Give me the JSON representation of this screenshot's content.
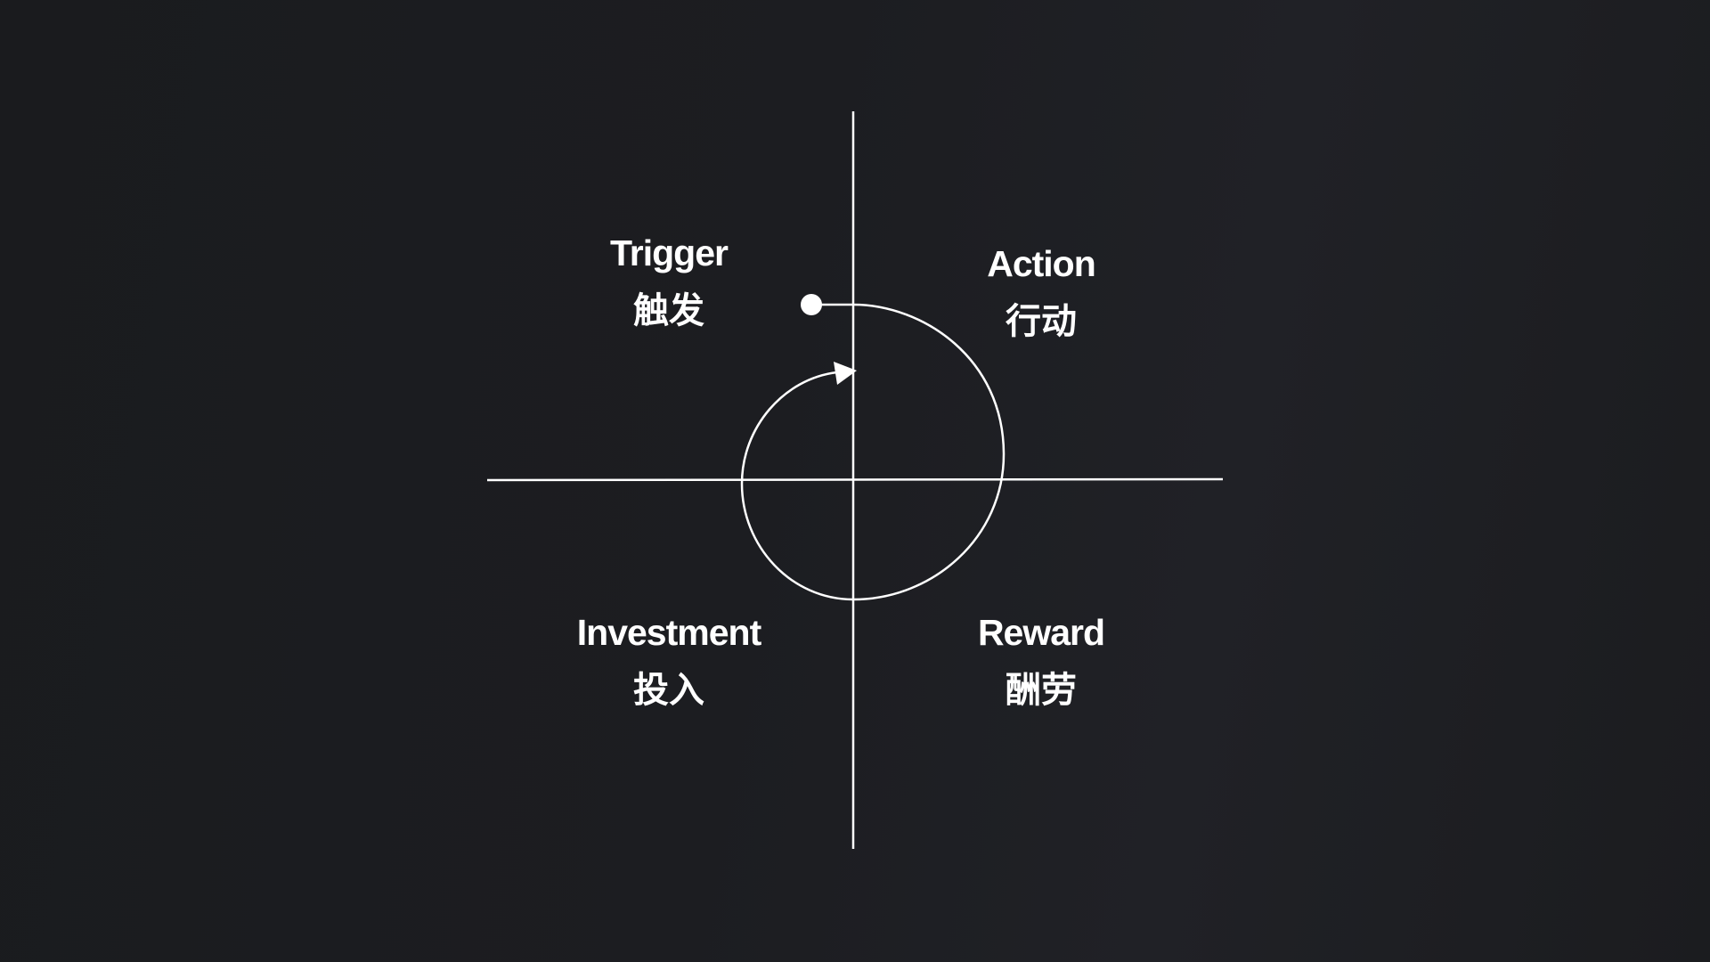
{
  "quadrants": {
    "trigger": {
      "en": "Trigger",
      "zh": "触发"
    },
    "action": {
      "en": "Action",
      "zh": "行动"
    },
    "investment": {
      "en": "Investment",
      "zh": "投入"
    },
    "reward": {
      "en": "Reward",
      "zh": "酬劳"
    }
  },
  "colors": {
    "background": "#1c1d21",
    "foreground": "#ffffff"
  }
}
